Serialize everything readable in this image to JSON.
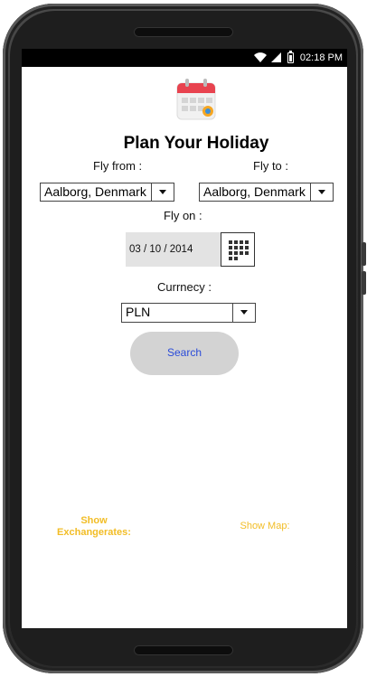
{
  "status_bar": {
    "time": "02:18 PM",
    "icons": [
      "wifi-icon",
      "signal-icon",
      "battery-icon"
    ]
  },
  "app": {
    "title": "Plan Your Holiday",
    "header_icon": "calendar-icon",
    "fly_from": {
      "label": "Fly from :",
      "value": "Aalborg, Denmark"
    },
    "fly_to": {
      "label": "Fly to :",
      "value": "Aalborg, Denmark"
    },
    "fly_on": {
      "label": "Fly on :",
      "value": "03 / 10 / 2014",
      "picker_icon": "calendar-grid-icon"
    },
    "currency": {
      "label": "Currnecy :",
      "value": "PLN"
    },
    "search_label": "Search",
    "show_exchangerates_label": "Show Exchangerates:",
    "show_map_label": "Show Map:"
  },
  "colors": {
    "accent_link": "#f2bd26",
    "search_text": "#2a4bd9",
    "search_bg": "#d3d3d3",
    "calendar_red": "#e8434f"
  }
}
